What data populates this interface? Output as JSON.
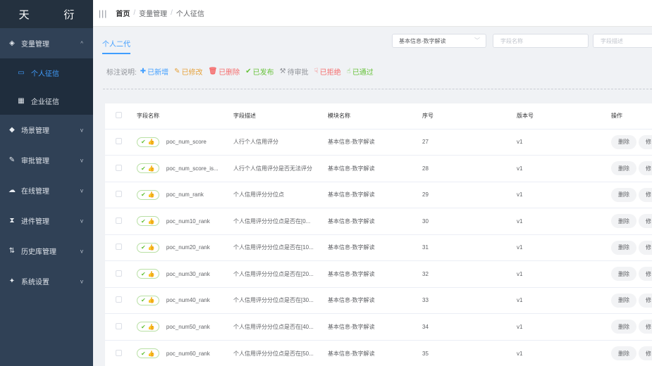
{
  "app": {
    "logo": "天 衍"
  },
  "sidebar": {
    "groups": [
      {
        "id": "var",
        "label": "变量管理",
        "icon": "cubes-icon",
        "glyph": "◈",
        "chevron": "^"
      },
      {
        "id": "scene",
        "label": "场景管理",
        "icon": "box-icon",
        "glyph": "◆",
        "chevron": "v"
      },
      {
        "id": "approval",
        "label": "审批管理",
        "icon": "gavel-icon",
        "glyph": "✎",
        "chevron": "v"
      },
      {
        "id": "online",
        "label": "在线管理",
        "icon": "cloud-upload-icon",
        "glyph": "☁",
        "chevron": "v"
      },
      {
        "id": "progress",
        "label": "进件管理",
        "icon": "hourglass-icon",
        "glyph": "⧗",
        "chevron": "v"
      },
      {
        "id": "history",
        "label": "历史库管理",
        "icon": "sort-list-icon",
        "glyph": "⇅",
        "chevron": "v"
      },
      {
        "id": "settings",
        "label": "系统设置",
        "icon": "wrench-icon",
        "glyph": "✦",
        "chevron": "v"
      }
    ],
    "sub_items": [
      {
        "label": "个人征信",
        "icon": "id-card-icon",
        "glyph": "▭",
        "active": true
      },
      {
        "label": "企业征信",
        "icon": "bank-icon",
        "glyph": "▦",
        "active": false
      }
    ]
  },
  "breadcrumb": {
    "items": [
      "首页",
      "变量管理",
      "个人征信"
    ]
  },
  "tabs": {
    "active": "个人二代"
  },
  "filters": {
    "select_value": "基本信息-数字解读",
    "field_name_placeholder": "字段名称",
    "field_desc_placeholder": "字段描述"
  },
  "legend": {
    "label": "标注说明:",
    "items": [
      {
        "glyph": "✚",
        "text": "已新增",
        "color": "#409eff",
        "icon": "plus-icon"
      },
      {
        "glyph": "✎",
        "text": "已修改",
        "color": "#e6a23c",
        "icon": "pencil-icon"
      },
      {
        "glyph": "🗑",
        "text": "已删除",
        "color": "#f56c6c",
        "icon": "trash-icon"
      },
      {
        "glyph": "✔",
        "text": "已发布",
        "color": "#67c23a",
        "icon": "check-icon"
      },
      {
        "glyph": "⚒",
        "text": "待审批",
        "color": "#909399",
        "icon": "gavel-icon"
      },
      {
        "glyph": "☟",
        "text": "已拒绝",
        "color": "#f56c6c",
        "icon": "thumbs-down-icon"
      },
      {
        "glyph": "☝",
        "text": "已通过",
        "color": "#67c23a",
        "icon": "thumbs-up-icon"
      }
    ]
  },
  "table": {
    "columns": [
      "字段名称",
      "字段描述",
      "模块名称",
      "序号",
      "版本号",
      "操作"
    ],
    "status_glyphs": [
      "✔",
      "👍"
    ],
    "actions": [
      "删除",
      "修"
    ],
    "rows": [
      {
        "name": "poc_num_score",
        "desc": "人行个人信用评分",
        "module": "基本信息-数字解读",
        "seq": "27",
        "ver": "v1"
      },
      {
        "name": "poc_num_score_is...",
        "desc": "人行个人信用评分是否无法评分",
        "module": "基本信息-数字解读",
        "seq": "28",
        "ver": "v1"
      },
      {
        "name": "poc_num_rank",
        "desc": "个人信用评分分位点",
        "module": "基本信息-数字解读",
        "seq": "29",
        "ver": "v1"
      },
      {
        "name": "poc_num10_rank",
        "desc": "个人信用评分分位点是否在[0...",
        "module": "基本信息-数字解读",
        "seq": "30",
        "ver": "v1"
      },
      {
        "name": "poc_num20_rank",
        "desc": "个人信用评分分位点是否在[10...",
        "module": "基本信息-数字解读",
        "seq": "31",
        "ver": "v1"
      },
      {
        "name": "poc_num30_rank",
        "desc": "个人信用评分分位点是否在[20...",
        "module": "基本信息-数字解读",
        "seq": "32",
        "ver": "v1"
      },
      {
        "name": "poc_num40_rank",
        "desc": "个人信用评分分位点是否在[30...",
        "module": "基本信息-数字解读",
        "seq": "33",
        "ver": "v1"
      },
      {
        "name": "poc_num50_rank",
        "desc": "个人信用评分分位点是否在[40...",
        "module": "基本信息-数字解读",
        "seq": "34",
        "ver": "v1"
      },
      {
        "name": "poc_num60_rank",
        "desc": "个人信用评分分位点是否在[50...",
        "module": "基本信息-数字解读",
        "seq": "35",
        "ver": "v1"
      }
    ]
  }
}
